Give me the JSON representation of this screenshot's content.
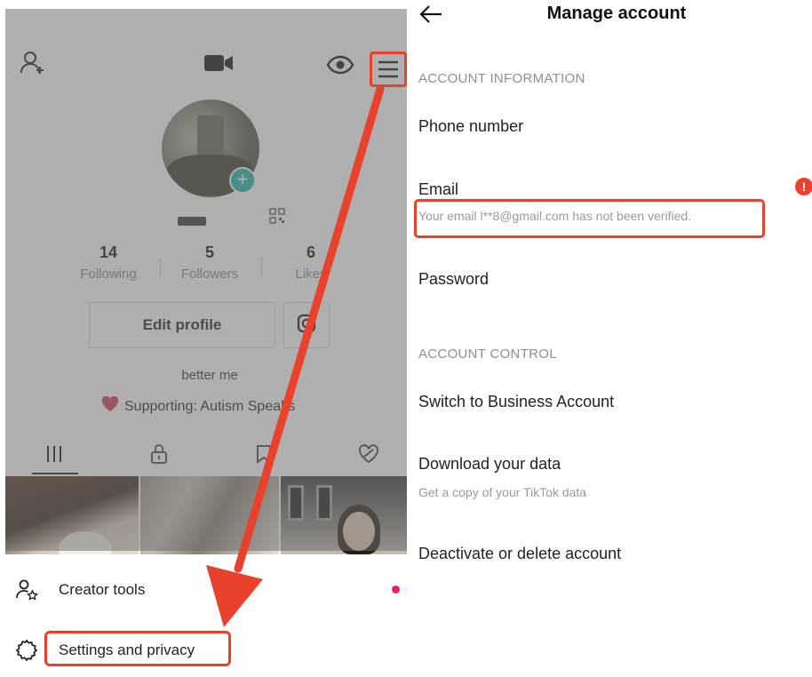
{
  "profile": {
    "stats": [
      {
        "num": "14",
        "label": "Following"
      },
      {
        "num": "5",
        "label": "Followers"
      },
      {
        "num": "6",
        "label": "Likes"
      }
    ],
    "edit_profile_label": "Edit profile",
    "bio": "better me",
    "supporting": "Supporting: Autism Speaks"
  },
  "menu": {
    "creator_tools": "Creator tools",
    "settings_privacy": "Settings and privacy"
  },
  "manage_account": {
    "title": "Manage account",
    "section_info": "ACCOUNT INFORMATION",
    "phone_label": "Phone number",
    "email_label": "Email",
    "email_warning": "Your email l**8@gmail.com has not been verified.",
    "password_label": "Password",
    "section_control": "ACCOUNT CONTROL",
    "switch_business": "Switch to Business Account",
    "download_data": "Download your data",
    "download_sub": "Get a copy of your TikTok data",
    "deactivate": "Deactivate or delete account"
  },
  "colors": {
    "highlight": "#e8412c",
    "accent_teal": "#20b7b0",
    "notification_dot": "#e0245e"
  },
  "icons": [
    "add-friend-icon",
    "video-icon",
    "eye-icon",
    "hamburger-menu-icon",
    "qr-code-icon",
    "instagram-icon",
    "heart-icon",
    "grid-icon",
    "lock-icon",
    "bookmark-icon",
    "liked-icon",
    "creator-tools-icon",
    "settings-gear-icon",
    "back-arrow-icon",
    "alert-icon"
  ]
}
